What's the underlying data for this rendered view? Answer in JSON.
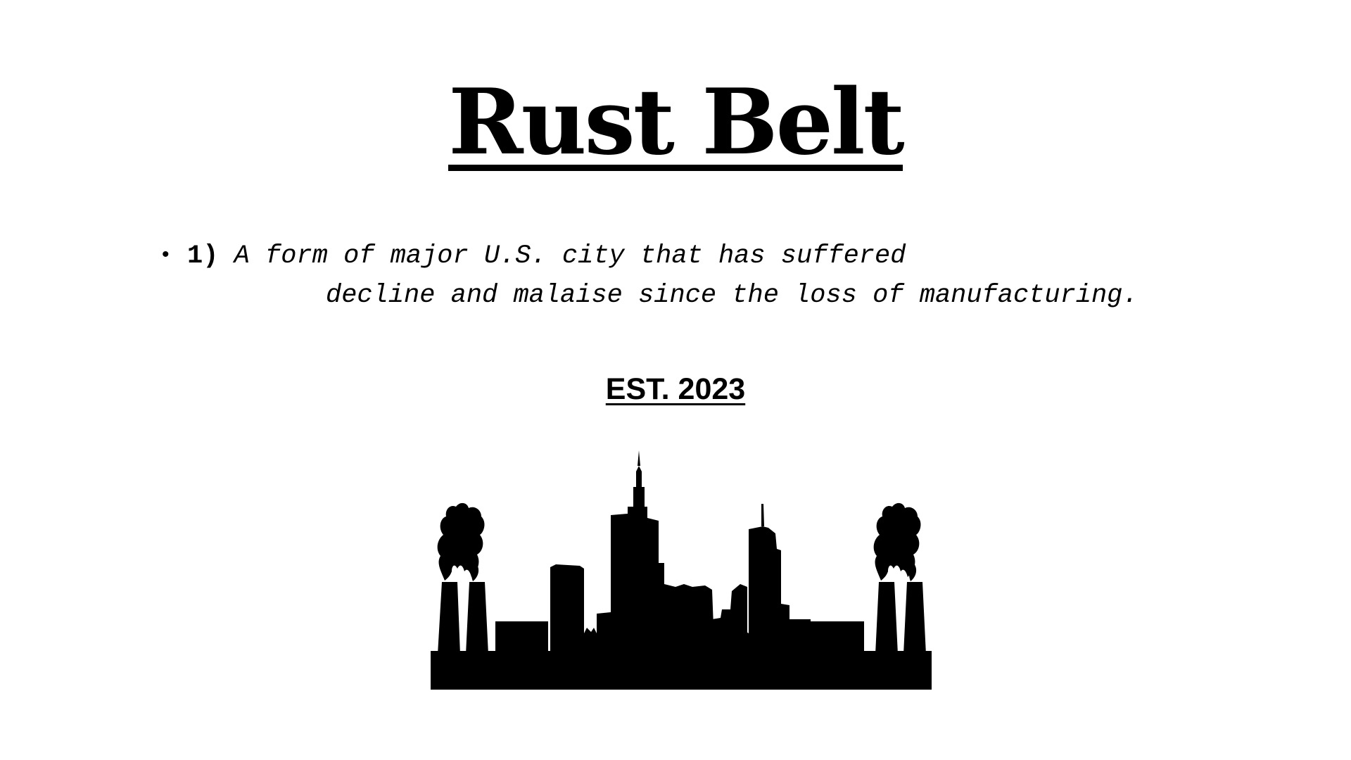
{
  "title": "Rust Belt",
  "definition": {
    "bullet": "•",
    "number": "1)",
    "line1": "A form of major U.S. city that has suffered",
    "line2": "decline and malaise since the loss of manufacturing."
  },
  "established": "EST. 2023",
  "illustration": {
    "name": "industrial-skyline",
    "color": "#000000"
  }
}
